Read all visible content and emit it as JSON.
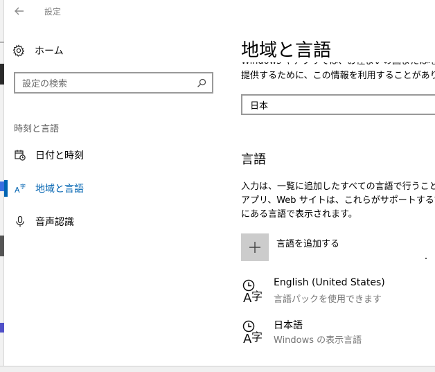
{
  "window": {
    "title": "設定"
  },
  "sidebar": {
    "home_label": "ホーム",
    "search_placeholder": "設定の検索",
    "section_title": "時刻と言語",
    "items": [
      {
        "label": "日付と時刻",
        "icon": "calendar-clock-icon",
        "active": false
      },
      {
        "label": "地域と言語",
        "icon": "language-icon",
        "active": true
      },
      {
        "label": "音声認識",
        "icon": "microphone-icon",
        "active": false
      }
    ]
  },
  "main": {
    "title": "地域と言語",
    "country_desc_line1": "Windows やアプリでは、お住まいの国または地",
    "country_desc_line2": "提供するために、この情報を利用することがありま",
    "country_value": "日本",
    "languages_heading": "言語",
    "languages_desc_line1": "入力は、一覧に追加したすべての言語で行うこと",
    "languages_desc_line2": "アプリ、Web サイトは、これらがサポートする言語",
    "languages_desc_line3": "にある言語で表示されます。",
    "add_language_label": "言語を追加する",
    "languages": [
      {
        "name": "English (United States)",
        "status": "言語パックを使用できます"
      },
      {
        "name": "日本語",
        "status": "Windows の表示言語"
      }
    ]
  },
  "colors": {
    "accent": "#0063b1",
    "plus_box": "#cccccc"
  }
}
